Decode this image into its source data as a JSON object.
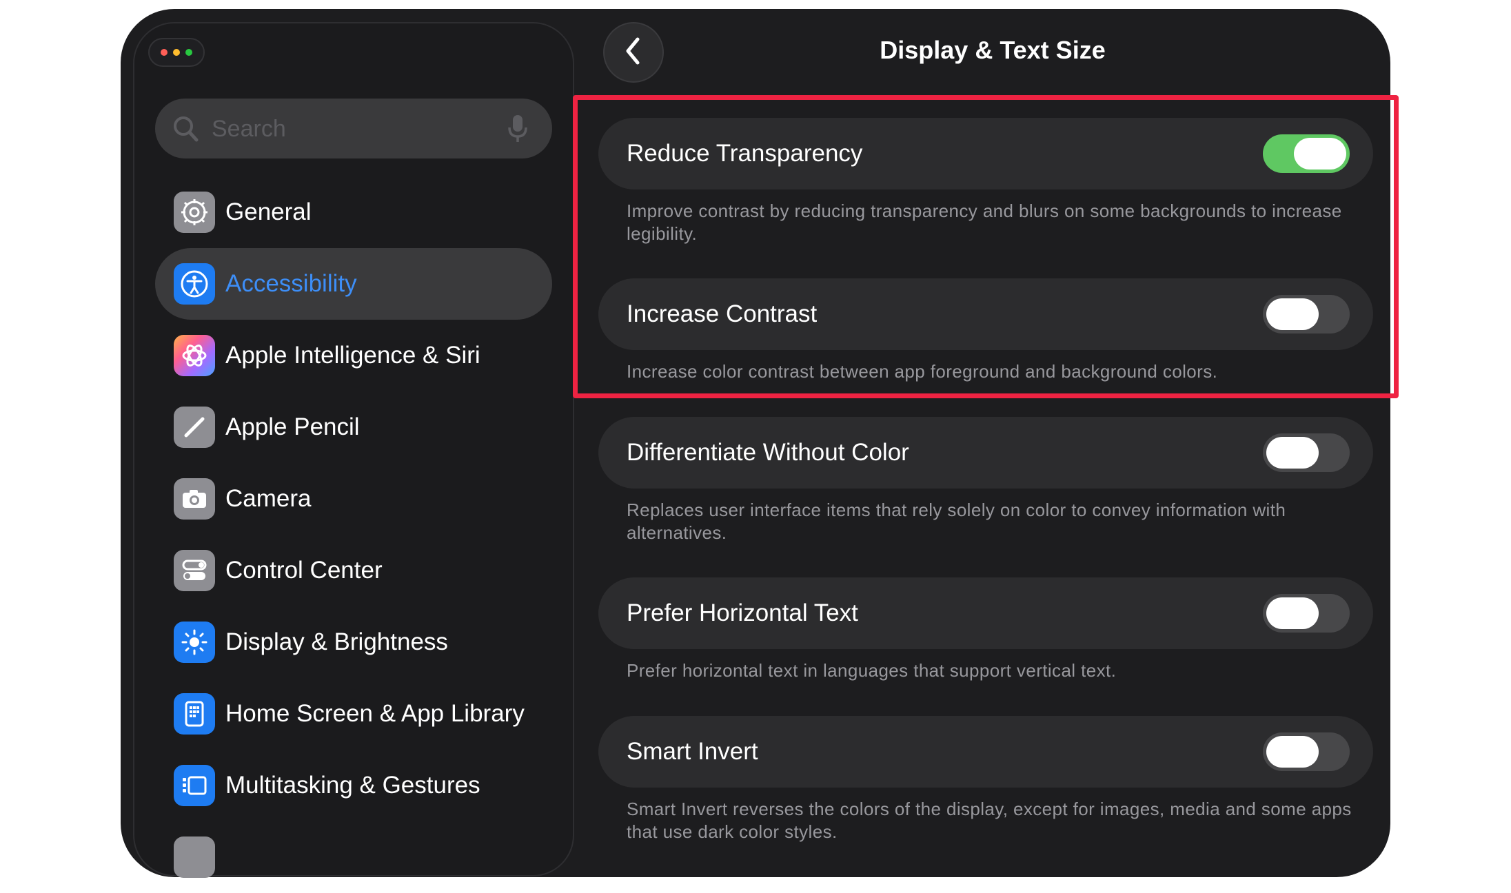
{
  "search": {
    "placeholder": "Search"
  },
  "sidebar": {
    "items": [
      {
        "label": "General",
        "icon": "gear-icon",
        "color": "#8e8e93"
      },
      {
        "label": "Accessibility",
        "icon": "accessibility-icon",
        "color": "#1e7cf2",
        "selected": true
      },
      {
        "label": "Apple Intelligence & Siri",
        "icon": "siri-icon",
        "color": "#ff6a6a"
      },
      {
        "label": "Apple Pencil",
        "icon": "pencil-icon",
        "color": "#8e8e93"
      },
      {
        "label": "Camera",
        "icon": "camera-icon",
        "color": "#8e8e93"
      },
      {
        "label": "Control Center",
        "icon": "control-center-icon",
        "color": "#8e8e93"
      },
      {
        "label": "Display & Brightness",
        "icon": "brightness-icon",
        "color": "#1e7cf2"
      },
      {
        "label": "Home Screen & App Library",
        "icon": "home-screen-icon",
        "color": "#1e7cf2"
      },
      {
        "label": "Multitasking & Gestures",
        "icon": "multitasking-icon",
        "color": "#1e7cf2"
      }
    ]
  },
  "header": {
    "title": "Display & Text Size"
  },
  "settings": [
    {
      "label": "Reduce Transparency",
      "on": true,
      "description": "Improve contrast by reducing transparency and blurs on some backgrounds to increase legibility."
    },
    {
      "label": "Increase Contrast",
      "on": false,
      "description": "Increase color contrast between app foreground and background colors."
    },
    {
      "label": "Differentiate Without Color",
      "on": false,
      "description": "Replaces user interface items that rely solely on color to convey information with alternatives."
    },
    {
      "label": "Prefer Horizontal Text",
      "on": false,
      "description": "Prefer horizontal text in languages that support vertical text."
    },
    {
      "label": "Smart Invert",
      "on": false,
      "description": "Smart Invert reverses the colors of the display, except for images, media and some apps that use dark color styles."
    }
  ],
  "colors": {
    "accent": "#3d8ef7",
    "toggle_on": "#5fc862",
    "highlight": "#ee2342",
    "window_dots": [
      "#ff5f57",
      "#febc2e",
      "#28c840"
    ]
  }
}
